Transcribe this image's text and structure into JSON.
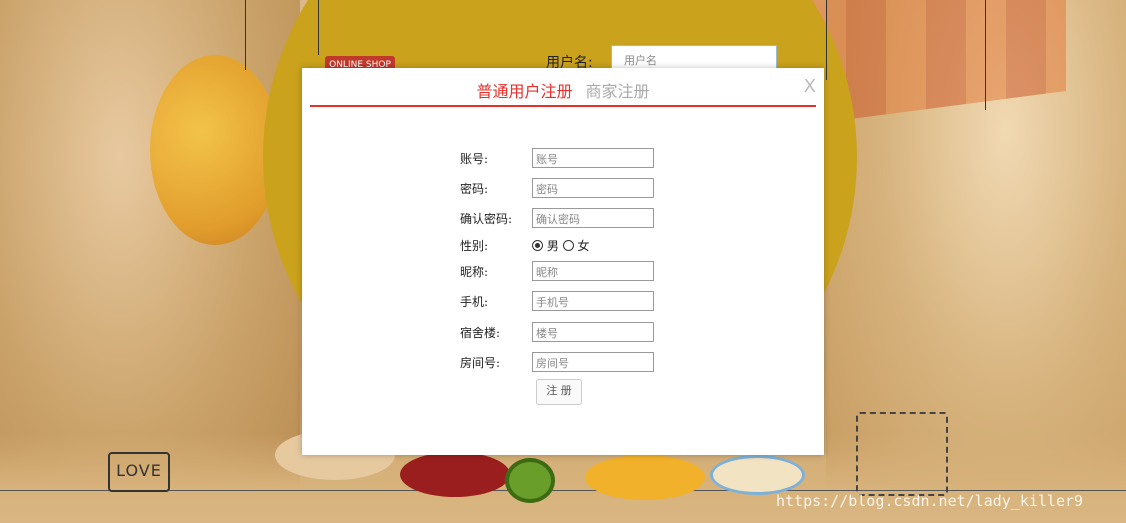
{
  "background": {
    "username_label": "用户名:",
    "username_placeholder": "用户名",
    "shop_sign": "ONLINE SHOP",
    "love_text": "LOVE",
    "watermark": "https://blog.csdn.net/lady_killer9"
  },
  "modal": {
    "tabs": [
      {
        "label": "普通用户注册",
        "active": true
      },
      {
        "label": "商家注册",
        "active": false
      }
    ],
    "close_label": "X",
    "accent_color": "#e6302c",
    "fields": {
      "account": {
        "label": "账号:",
        "placeholder": "账号"
      },
      "password": {
        "label": "密码:",
        "placeholder": "密码"
      },
      "confirm_password": {
        "label": "确认密码:",
        "placeholder": "确认密码"
      },
      "gender": {
        "label": "性别:",
        "options": [
          "男",
          "女"
        ],
        "selected": "男"
      },
      "nickname": {
        "label": "昵称:",
        "placeholder": "昵称"
      },
      "phone": {
        "label": "手机:",
        "placeholder": "手机号"
      },
      "dorm": {
        "label": "宿舍楼:",
        "placeholder": "楼号"
      },
      "room": {
        "label": "房间号:",
        "placeholder": "房间号"
      }
    },
    "submit_label": "注 册"
  }
}
